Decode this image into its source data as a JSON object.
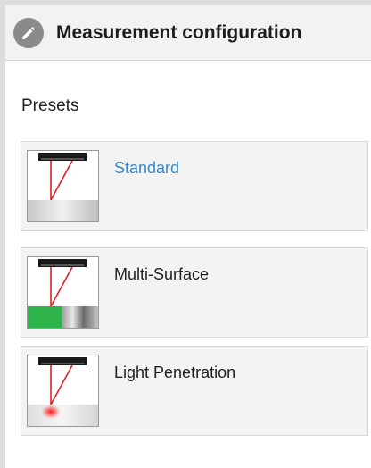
{
  "header": {
    "title": "Measurement configuration",
    "icon": "pencil-icon"
  },
  "presets": {
    "label": "Presets",
    "items": [
      {
        "label": "Standard",
        "active": true,
        "icon": "sensor-standard-icon"
      },
      {
        "label": "Multi-Surface",
        "active": false,
        "icon": "sensor-multi-surface-icon"
      },
      {
        "label": "Light Penetration",
        "active": false,
        "icon": "sensor-light-penetration-icon"
      }
    ]
  },
  "colors": {
    "accent": "#3a87c8",
    "laser": "#e02020",
    "green_surface": "#2eb34a"
  }
}
